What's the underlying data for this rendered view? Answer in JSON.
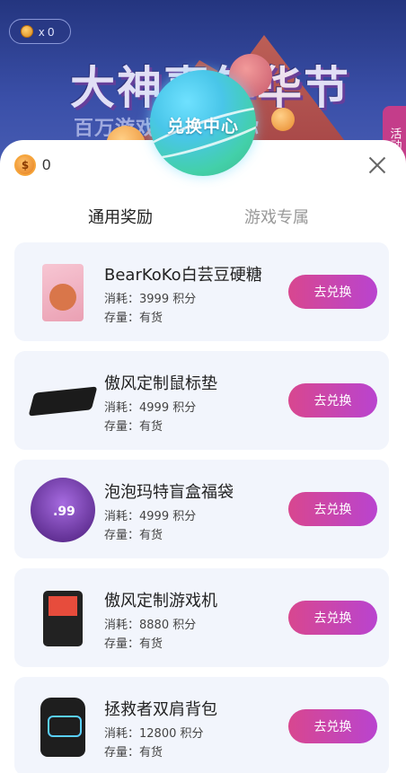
{
  "header": {
    "coin_count": "x 0",
    "banner_title": "大神嘉年华节",
    "banner_subtitle": "百万游戏豪礼送给你",
    "side_tab": "活动"
  },
  "modal": {
    "title": "兑换中心",
    "balance": "0",
    "tabs": [
      {
        "label": "通用奖励",
        "active": true
      },
      {
        "label": "游戏专属",
        "active": false
      }
    ],
    "items": [
      {
        "name": "BearKoKo白芸豆硬糖",
        "cost": "消耗：3999 积分",
        "stock": "存量：有货",
        "button": "去兑换",
        "icon": "candy-box-icon"
      },
      {
        "name": "傲风定制鼠标垫",
        "cost": "消耗：4999 积分",
        "stock": "存量：有货",
        "button": "去兑换",
        "icon": "mousepad-icon"
      },
      {
        "name": "泡泡玛特盲盒福袋",
        "cost": "消耗：4999 积分",
        "stock": "存量：有货",
        "button": "去兑换",
        "icon": "lucky-bag-icon"
      },
      {
        "name": "傲风定制游戏机",
        "cost": "消耗：8880 积分",
        "stock": "存量：有货",
        "button": "去兑换",
        "icon": "game-console-icon"
      },
      {
        "name": "拯救者双肩背包",
        "cost": "消耗：12800 积分",
        "stock": "存量：有货",
        "button": "去兑换",
        "icon": "backpack-icon"
      }
    ]
  },
  "colors": {
    "accent_start": "#d8478f",
    "accent_end": "#b944cf",
    "card_bg": "#f2f5fc"
  }
}
